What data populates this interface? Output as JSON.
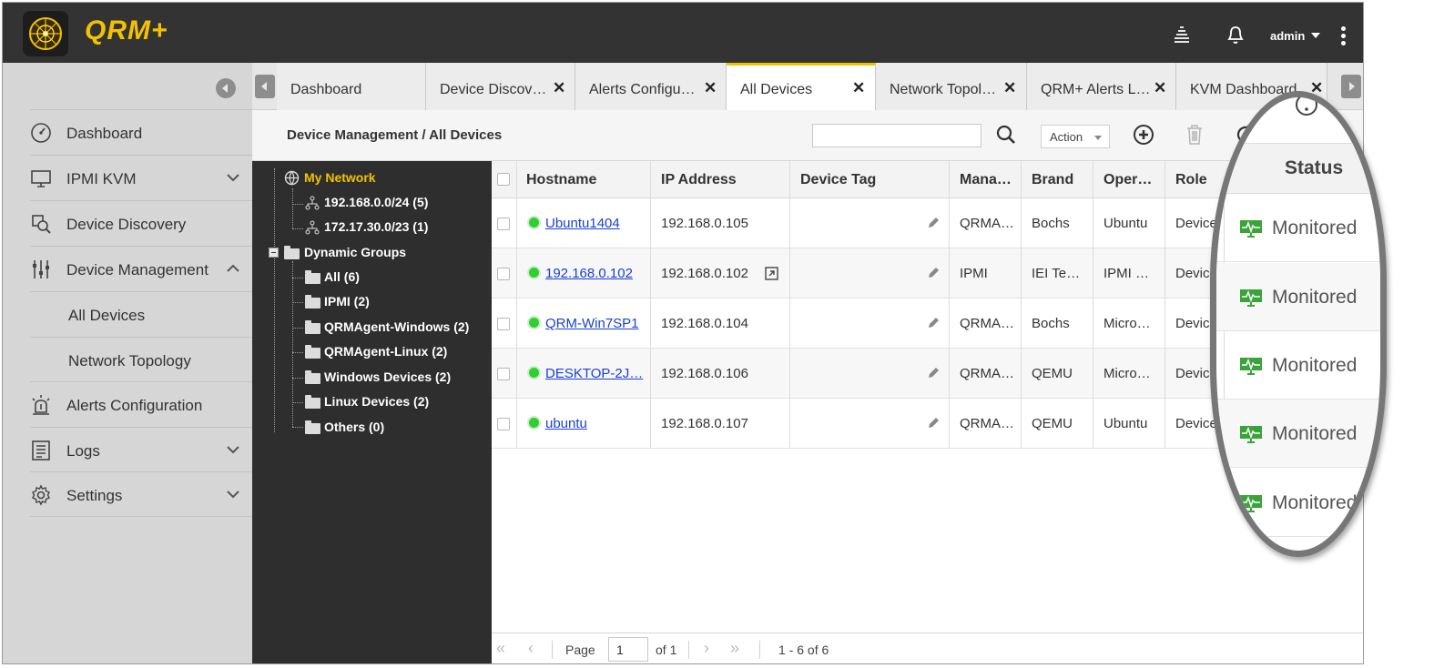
{
  "app": {
    "logo_text": "QRM+",
    "user": "admin",
    "brand_color": "#f2c200"
  },
  "sidebar": {
    "items": [
      {
        "label": "Dashboard",
        "icon": "dashboard-gauge-icon"
      },
      {
        "label": "IPMI KVM",
        "icon": "monitor-icon",
        "expandable": true
      },
      {
        "label": "Device Discovery",
        "icon": "discovery-icon"
      },
      {
        "label": "Device Management",
        "icon": "sliders-icon",
        "expanded": true
      },
      {
        "label": "Alerts Configuration",
        "icon": "alarm-icon"
      },
      {
        "label": "Logs",
        "icon": "logs-icon",
        "expandable": true
      },
      {
        "label": "Settings",
        "icon": "gear-icon",
        "expandable": true
      }
    ],
    "sub_items": [
      {
        "label": "All Devices"
      },
      {
        "label": "Network Topology"
      }
    ]
  },
  "tabs": [
    {
      "label": "Dashboard",
      "closable": false
    },
    {
      "label": "Device Discov…",
      "closable": true
    },
    {
      "label": "Alerts Configu…",
      "closable": true
    },
    {
      "label": "All Devices",
      "closable": true,
      "active": true
    },
    {
      "label": "Network Topol…",
      "closable": true
    },
    {
      "label": "QRM+ Alerts L…",
      "closable": true
    },
    {
      "label": "KVM Dashboard",
      "closable": true
    }
  ],
  "close_glyph": "✕",
  "toolbar": {
    "breadcrumb": "Device Management / All Devices",
    "search_value": "",
    "action_label": "Action"
  },
  "tree": {
    "root": "My Network",
    "subnets": [
      "192.168.0.0/24 (5)",
      "172.17.30.0/23 (1)"
    ],
    "groups_label": "Dynamic Groups",
    "groups": [
      "All (6)",
      "IPMI (2)",
      "QRMAgent-Windows (2)",
      "QRMAgent-Linux (2)",
      "Windows Devices (2)",
      "Linux Devices (2)",
      "Others (0)"
    ]
  },
  "grid": {
    "columns": [
      "Hostname",
      "IP Address",
      "Device Tag",
      "Mana…",
      "Brand",
      "Oper…",
      "Role"
    ],
    "rows": [
      {
        "hostname": "Ubuntu1404",
        "ip": "192.168.0.105",
        "mana": "QRMA…",
        "brand": "Bochs",
        "os": "Ubuntu",
        "role": "Device"
      },
      {
        "hostname": "192.168.0.102",
        "ip": "192.168.0.102",
        "mana": "IPMI",
        "brand": "IEI Te…",
        "os": "IPMI …",
        "role": "Device"
      },
      {
        "hostname": "QRM-Win7SP1",
        "ip": "192.168.0.104",
        "mana": "QRMA…",
        "brand": "Bochs",
        "os": "Micro…",
        "role": "Device"
      },
      {
        "hostname": "DESKTOP-2J…",
        "ip": "192.168.0.106",
        "mana": "QRMA…",
        "brand": "QEMU",
        "os": "Micro…",
        "role": "Device"
      },
      {
        "hostname": "ubuntu",
        "ip": "192.168.0.107",
        "mana": "QRMA…",
        "brand": "QEMU",
        "os": "Ubuntu",
        "role": "Device"
      }
    ],
    "status_color": "#33cc33"
  },
  "pager": {
    "page_label": "Page",
    "page_value": "1",
    "of_label": "of 1",
    "summary": "1 - 6 of 6"
  },
  "callout": {
    "header": "Status",
    "status_values": [
      "Monitored",
      "Monitored",
      "Monitored",
      "Monitored",
      "Monitored"
    ]
  }
}
